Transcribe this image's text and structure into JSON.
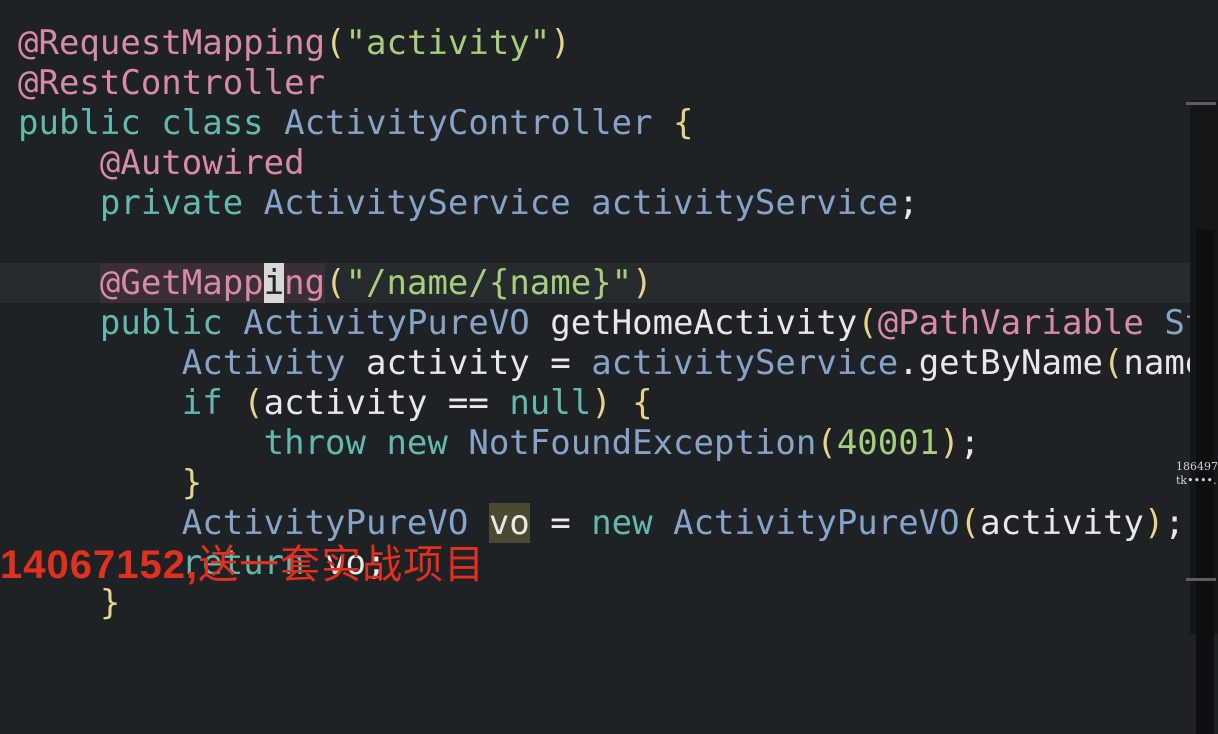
{
  "editor": {
    "current_line": 7,
    "lines": [
      [
        [
          "ann",
          "@RequestMapping"
        ],
        [
          "punc",
          "("
        ],
        [
          "str",
          "\"activity\""
        ],
        [
          "punc",
          ")"
        ]
      ],
      [
        [
          "ann",
          "@RestController"
        ]
      ],
      [
        [
          "kw",
          "public class "
        ],
        [
          "type",
          "ActivityController "
        ],
        [
          "punc",
          "{"
        ]
      ],
      [
        [
          "id",
          "    "
        ],
        [
          "ann",
          "@Autowired"
        ]
      ],
      [
        [
          "id",
          "    "
        ],
        [
          "kw",
          "private "
        ],
        [
          "type",
          "ActivityService "
        ],
        [
          "type",
          "activityService"
        ],
        [
          "op",
          ";"
        ]
      ],
      [],
      [
        [
          "id",
          "    "
        ],
        [
          "ann annhl",
          "@GetMapp"
        ],
        [
          "ann caret",
          "i"
        ],
        [
          "ann annhl",
          "ng"
        ],
        [
          "punc",
          "("
        ],
        [
          "str",
          "\"/name/{name}\""
        ],
        [
          "punc",
          ")"
        ]
      ],
      [
        [
          "id",
          "    "
        ],
        [
          "kw",
          "public "
        ],
        [
          "type",
          "ActivityPureVO "
        ],
        [
          "id",
          "getHomeActivity"
        ],
        [
          "punc",
          "("
        ],
        [
          "ann",
          "@PathVariable "
        ],
        [
          "type",
          "Str"
        ]
      ],
      [
        [
          "id",
          "        "
        ],
        [
          "type",
          "Activity "
        ],
        [
          "id",
          "activity "
        ],
        [
          "op",
          "= "
        ],
        [
          "type",
          "activityService"
        ],
        [
          "id",
          ".getByName"
        ],
        [
          "punc",
          "("
        ],
        [
          "id",
          "name"
        ],
        [
          "punc",
          ")"
        ]
      ],
      [
        [
          "id",
          "        "
        ],
        [
          "kw",
          "if "
        ],
        [
          "punc",
          "("
        ],
        [
          "id",
          "activity "
        ],
        [
          "op",
          "== "
        ],
        [
          "kw",
          "null"
        ],
        [
          "punc",
          ") {"
        ]
      ],
      [
        [
          "id",
          "            "
        ],
        [
          "kw",
          "throw new "
        ],
        [
          "type",
          "NotFoundException"
        ],
        [
          "punc",
          "("
        ],
        [
          "num",
          "40001"
        ],
        [
          "punc",
          ")"
        ],
        [
          "op",
          ";"
        ]
      ],
      [
        [
          "id",
          "        "
        ],
        [
          "punc",
          "}"
        ]
      ],
      [
        [
          "id",
          "        "
        ],
        [
          "type",
          "ActivityPureVO "
        ],
        [
          "id mark",
          "vo"
        ],
        [
          "op",
          " = "
        ],
        [
          "kw",
          "new "
        ],
        [
          "type",
          "ActivityPureVO"
        ],
        [
          "punc",
          "("
        ],
        [
          "id",
          "activity"
        ],
        [
          "punc",
          ")"
        ],
        [
          "op",
          ";"
        ]
      ],
      [
        [
          "id",
          "        "
        ],
        [
          "kw",
          "return "
        ],
        [
          "id",
          "vo"
        ],
        [
          "op",
          ";"
        ]
      ],
      [
        [
          "id",
          "    "
        ],
        [
          "punc",
          "}"
        ]
      ]
    ]
  },
  "watermark": {
    "line1": "186497",
    "line2": "tk••••."
  },
  "overlay": {
    "number": "14067152,",
    "text": "送一套实战项目"
  }
}
